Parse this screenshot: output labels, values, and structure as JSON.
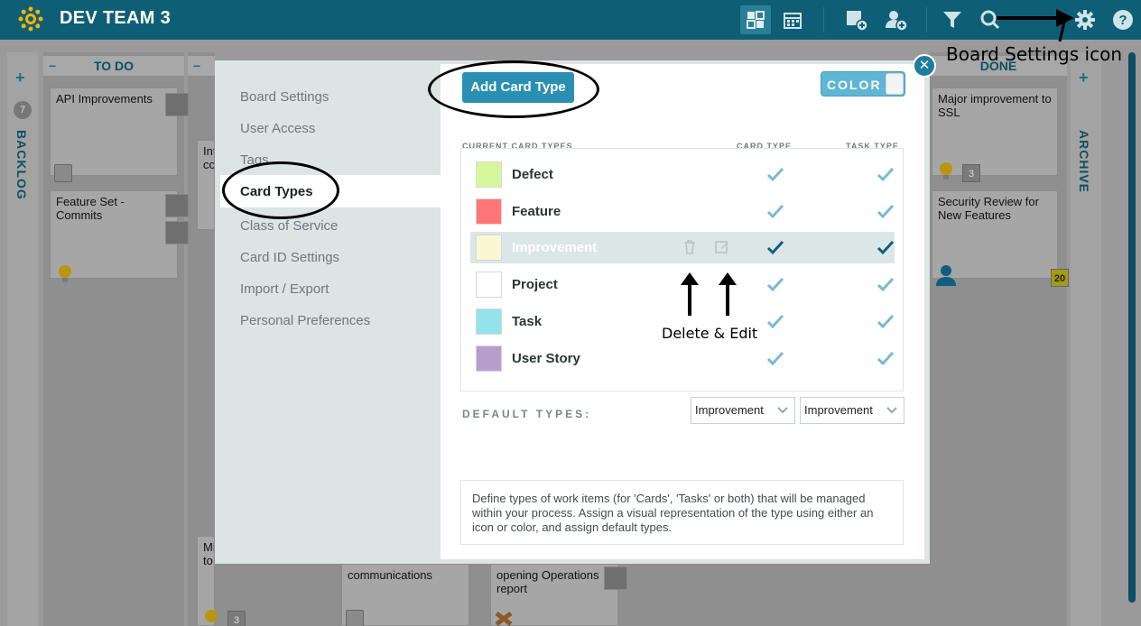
{
  "topbar": {
    "title": "DEV TEAM 3",
    "icons": [
      "board-view-icon",
      "calendar-view-icon",
      "add-card-icon",
      "add-user-icon",
      "filter-icon",
      "search-icon",
      "gear-icon",
      "help-icon"
    ]
  },
  "board": {
    "backlog_label": "BACKLOG",
    "backlog_count": "7",
    "archive_label": "ARCHIVE",
    "columns": {
      "todo": "TO DO",
      "done": "DONE"
    },
    "cards": {
      "api": "API Improvements",
      "feature_set": "Feature Set - Commits",
      "int_partial": "Int co",
      "mi_partial": "Mi to",
      "communications": "communications",
      "opening_ops": "opening Operations report",
      "major_ssl": "Major improvement to SSL",
      "security_review": "Security Review for New Features"
    },
    "badges": {
      "done_count": "3",
      "bottom_count": "3",
      "calendar_day": "20"
    }
  },
  "modal": {
    "nav": [
      "Board Settings",
      "User Access",
      "Tags",
      "Card Types",
      "Class of Service",
      "Card ID Settings",
      "Import / Export",
      "Personal Preferences"
    ],
    "active_nav": "Card Types",
    "add_button": "Add Card Type",
    "color_toggle": "COLOR",
    "headers": {
      "current": "CURRENT CARD TYPES",
      "card_type": "CARD TYPE",
      "task_type": "TASK TYPE"
    },
    "types": [
      {
        "name": "Defect",
        "color": "#d6f89a",
        "card": true,
        "task": true
      },
      {
        "name": "Feature",
        "color": "#ff7676",
        "card": true,
        "task": true
      },
      {
        "name": "Improvement",
        "color": "#fbf7d3",
        "card": true,
        "task": true
      },
      {
        "name": "Project",
        "color": "#ffffff",
        "card": true,
        "task": true
      },
      {
        "name": "Task",
        "color": "#93e3ea",
        "card": true,
        "task": true
      },
      {
        "name": "User Story",
        "color": "#b89ecc",
        "card": true,
        "task": true
      }
    ],
    "default_label": "DEFAULT TYPES:",
    "default_card": "Improvement",
    "default_task": "Improvement",
    "description": "Define types of work items (for 'Cards', 'Tasks' or both) that will be managed within your process. Assign a visual representation of the type using either an icon or color, and assign default types."
  },
  "annotations": {
    "board_settings": "Board Settings icon",
    "delete_edit": "Delete & Edit"
  },
  "colors": {
    "topbar": "#0e5f76",
    "accent": "#2b8fb4",
    "check": "#78b9d6",
    "check_dark": "#0f5f7d"
  }
}
